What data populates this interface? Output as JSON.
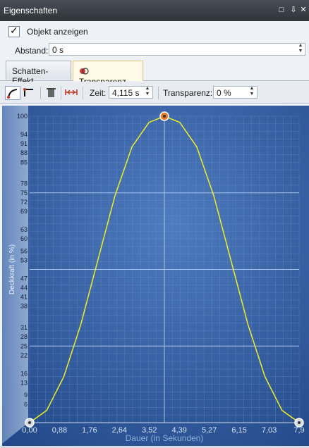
{
  "window": {
    "title": "Eigenschaften",
    "buttons": [
      "□",
      "⇩",
      "✕"
    ]
  },
  "object": {
    "checkbox_label": "Objekt anzeigen",
    "checked": true
  },
  "distance": {
    "label": "Abstand:",
    "value": "0 s"
  },
  "tabs": [
    {
      "label": "Schatten-Effekt",
      "active": false
    },
    {
      "label": "Transparenz",
      "active": true
    }
  ],
  "toolbar": {
    "time_label": "Zeit:",
    "time_value": "4,115 s",
    "transparency_label": "Transparenz:",
    "transparency_value": "0 %"
  },
  "chart_data": {
    "type": "line",
    "xlabel": "Dauer (in Sekunden)",
    "ylabel": "Deckkraft (in %)",
    "x_ticks": [
      "0,00",
      "0,88",
      "1,76",
      "2,64",
      "3,52",
      "4,39",
      "5,27",
      "6,15",
      "7,03",
      "7,9"
    ],
    "y_ticks": [
      "100",
      "94",
      "91",
      "88",
      "85",
      "78",
      "75",
      "72",
      "69",
      "63",
      "60",
      "56",
      "53",
      "47",
      "44",
      "41",
      "38",
      "31",
      "28",
      "25",
      "22",
      "16",
      "13",
      "9",
      "6"
    ],
    "xlim": [
      0,
      7.9
    ],
    "ylim": [
      0,
      100
    ],
    "series": [
      {
        "x": [
          0,
          0.5,
          1.0,
          1.5,
          2.0,
          2.5,
          3.0,
          3.5,
          3.95,
          4.4,
          4.9,
          5.4,
          5.9,
          6.4,
          6.9,
          7.4,
          7.9
        ],
        "y": [
          0,
          4,
          15,
          32,
          53,
          74,
          90,
          98,
          100,
          98,
          90,
          74,
          53,
          32,
          15,
          4,
          0
        ]
      }
    ],
    "keyframes": [
      {
        "x": 0,
        "y": 0
      },
      {
        "x": 3.95,
        "y": 100
      },
      {
        "x": 7.9,
        "y": 0
      }
    ],
    "line_color": "#f0f020",
    "grid": true
  }
}
